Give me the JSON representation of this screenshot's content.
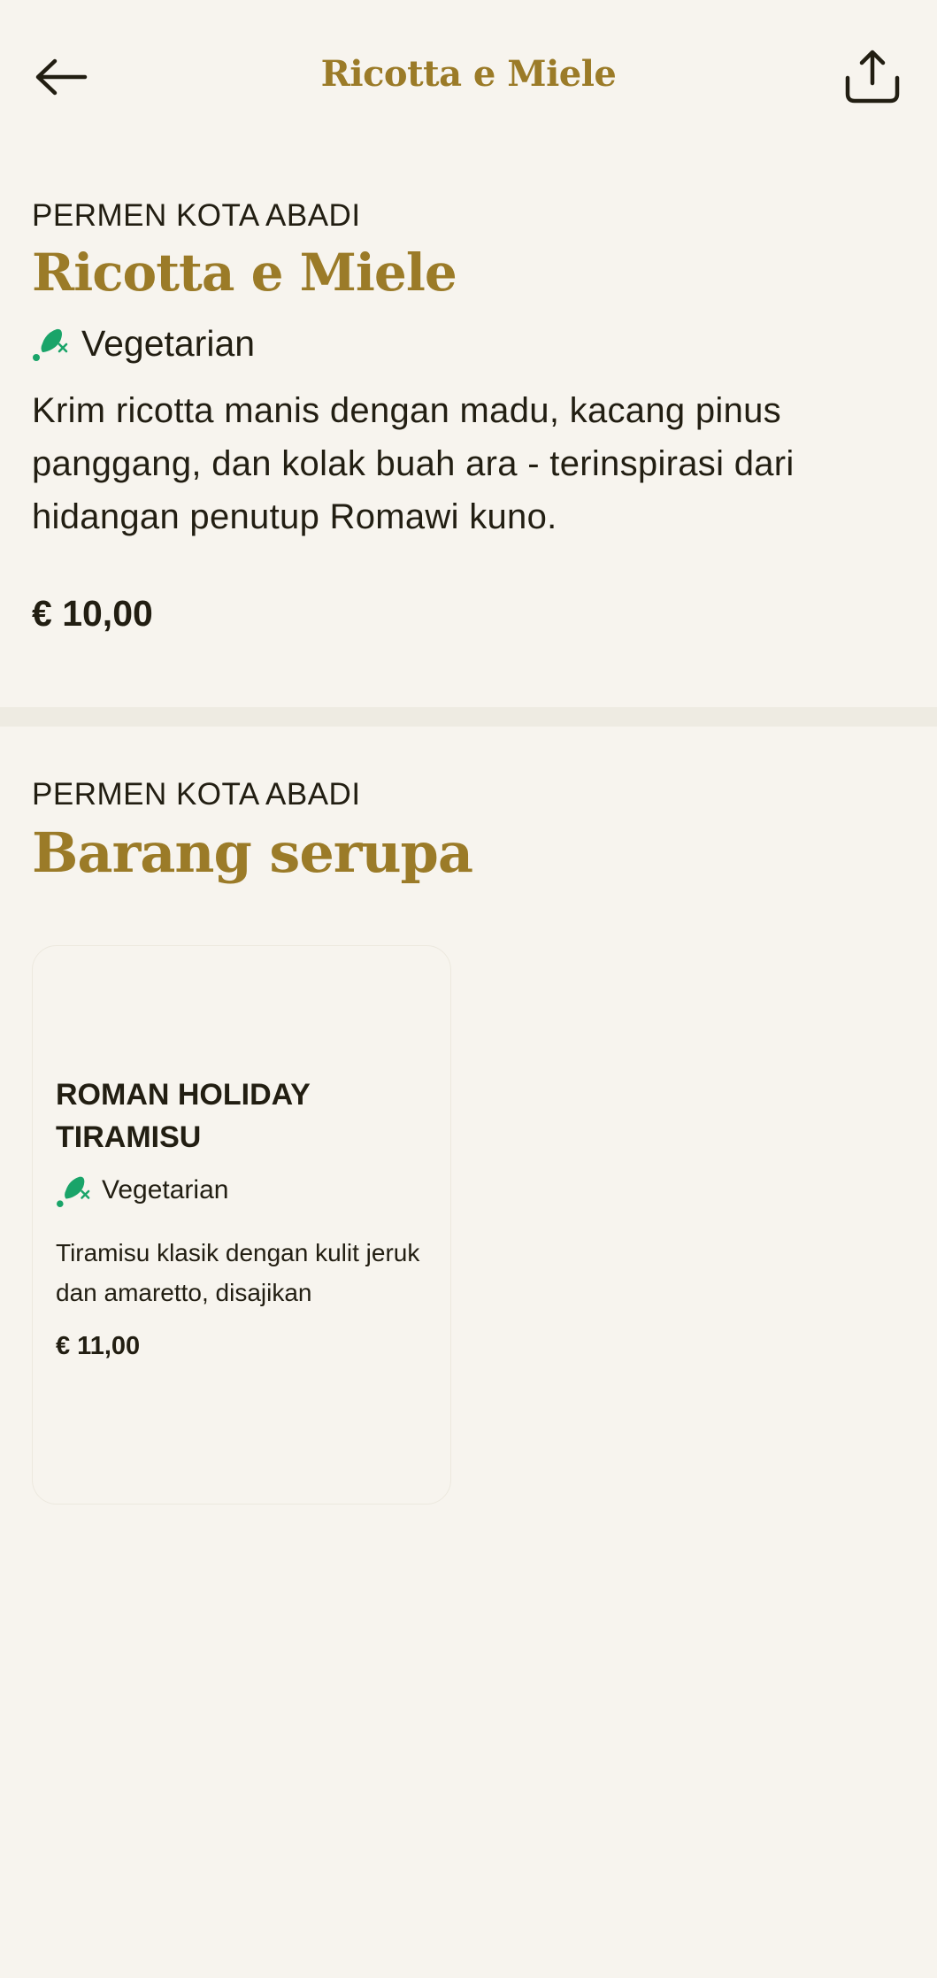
{
  "header": {
    "title": "Ricotta e Miele",
    "back_icon": "arrow-left-icon",
    "share_icon": "share-icon"
  },
  "item": {
    "category": "PERMEN KOTA ABADI",
    "name": "Ricotta e Miele",
    "diet_label": "Vegetarian",
    "diet_icon": "vegetarian-drumstick-icon",
    "description": "Krim ricotta manis dengan madu, kacang pinus panggang, dan kolak buah ara - terinspirasi dari hidangan penutup Romawi kuno.",
    "price": "€ 10,00"
  },
  "similar": {
    "category": "PERMEN KOTA ABADI",
    "heading": "Barang serupa",
    "items": [
      {
        "name": "ROMAN HOLIDAY TIRAMISU",
        "diet_label": "Vegetarian",
        "description": "Tiramisu klasik dengan kulit jeruk dan amaretto, disajikan",
        "price": "€ 11,00"
      }
    ]
  },
  "colors": {
    "background": "#f7f4ee",
    "accent_gold": "#9b7b28",
    "text": "#221e12",
    "veg_green": "#1aa469",
    "divider": "#eeebe2"
  }
}
